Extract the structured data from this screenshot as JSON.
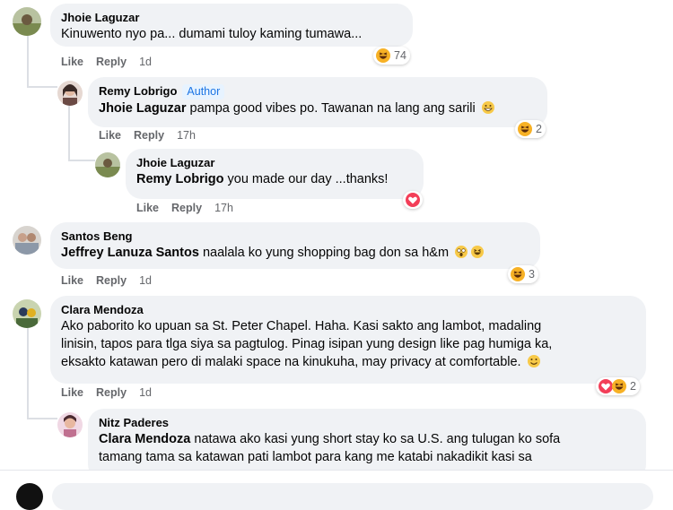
{
  "colors": {
    "bubble": "#f0f2f5",
    "meta": "#65676b",
    "author_badge": "#1b74e4",
    "heart": "#f33e58",
    "haha": "#f7b125"
  },
  "comments": [
    {
      "name": "Jhoie Laguzar",
      "text": "Kinuwento nyo pa... dumami tuloy kaming tumawa...",
      "actions": {
        "like": "Like",
        "reply": "Reply",
        "time": "1d"
      },
      "reaction": {
        "icons": [
          "haha-emoji"
        ],
        "count": "74"
      }
    },
    {
      "name": "Remy Lobrigo",
      "badge": "Author",
      "mention": "Jhoie Laguzar",
      "text": "pampa good vibes po. Tawanan na lang ang sarili",
      "actions": {
        "like": "Like",
        "reply": "Reply",
        "time": "17h"
      },
      "reaction": {
        "icons": [
          "haha-emoji"
        ],
        "count": "2"
      }
    },
    {
      "name": "Jhoie Laguzar",
      "mention": "Remy Lobrigo",
      "text": "you made our day ...thanks!",
      "actions": {
        "like": "Like",
        "reply": "Reply",
        "time": "17h"
      },
      "reaction": {
        "icons": [
          "heart-emoji"
        ],
        "count": ""
      }
    },
    {
      "name": "Santos Beng",
      "mention": "Jeffrey Lanuza Santos",
      "text": "naalala ko yung shopping bag don sa h&m",
      "actions": {
        "like": "Like",
        "reply": "Reply",
        "time": "1d"
      },
      "reaction": {
        "icons": [
          "haha-emoji"
        ],
        "count": "3"
      }
    },
    {
      "name": "Clara Mendoza",
      "text_lines": [
        "Ako paborito ko upuan sa St. Peter Chapel. Haha. Kasi sakto ang lambot, madaling",
        "linisin, tapos para tlga siya sa pagtulog. Pinag isipan yung design like pag humiga ka,",
        "eksakto katawan pero di malaki space na kinukuha, may privacy at comfortable."
      ],
      "actions": {
        "like": "Like",
        "reply": "Reply",
        "time": "1d"
      },
      "reaction": {
        "icons": [
          "heart-emoji",
          "haha-emoji"
        ],
        "count": "2"
      }
    },
    {
      "name": "Nitz Paderes",
      "mention": "Clara Mendoza",
      "text_lines": [
        "natawa ako kasi yung short stay ko sa U.S. ang tulugan ko sofa",
        "tamang tama sa katawan pati lambot para kang me katabi nakadikit kasi sa"
      ]
    }
  ]
}
